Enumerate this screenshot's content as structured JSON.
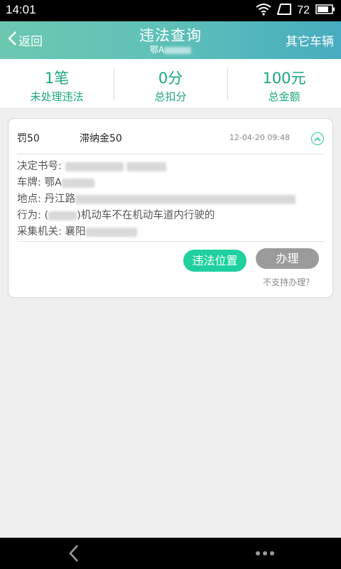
{
  "status_bar": {
    "time": "14:01",
    "battery": "72"
  },
  "header": {
    "back_label": "返回",
    "title": "违法查询",
    "plate_prefix": "鄂A",
    "other_label": "其它车辆"
  },
  "summary": [
    {
      "value": "1笔",
      "label": "未处理违法"
    },
    {
      "value": "0分",
      "label": "总扣分"
    },
    {
      "value": "100元",
      "label": "总金额"
    }
  ],
  "record": {
    "fine": "罚50",
    "late_fee": "滞纳金50",
    "datetime": "12-04-20 09:48",
    "decision_label": "决定书号:",
    "plate_label": "车牌:",
    "plate_value": "鄂A",
    "location_label": "地点:",
    "location_value": "丹江路",
    "behavior_label": "行为:",
    "behavior_prefix": "(",
    "behavior_value": ")机动车不在机动车道内行驶的",
    "agency_label": "采集机关:",
    "agency_value": "襄阳"
  },
  "actions": {
    "location_button": "违法位置",
    "handle_button": "办理",
    "unsupported_link": "不支持办理？"
  },
  "colors": {
    "accent": "#1fd19f",
    "summary_text": "#1aa67d",
    "header_start": "#6cc8b0",
    "header_end": "#47acc0"
  }
}
